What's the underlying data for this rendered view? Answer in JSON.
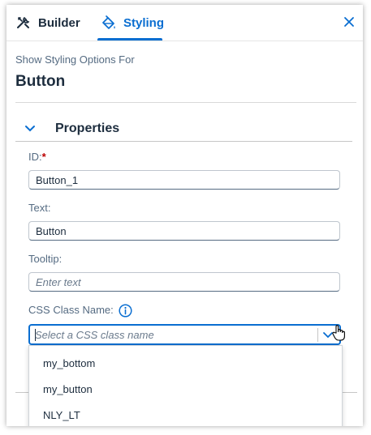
{
  "tabs": {
    "builder_label": "Builder",
    "styling_label": "Styling",
    "active": "Styling"
  },
  "header": {
    "subtitle": "Show Styling Options For",
    "title": "Button"
  },
  "section": {
    "label": "Properties",
    "expanded": true
  },
  "fields": {
    "id_label": "ID:",
    "id_required_marker": "*",
    "id_value": "Button_1",
    "text_label": "Text:",
    "text_value": "Button",
    "tooltip_label": "Tooltip:",
    "tooltip_placeholder": "Enter text",
    "css_label": "CSS Class Name:",
    "css_placeholder": "Select a CSS class name"
  },
  "dropdown": {
    "options": [
      "my_bottom",
      "my_button",
      "NLY_LT"
    ]
  },
  "colors": {
    "accent": "#0a6ed1",
    "text": "#1d2d3e",
    "label": "#556b82",
    "required": "#bb0000"
  }
}
